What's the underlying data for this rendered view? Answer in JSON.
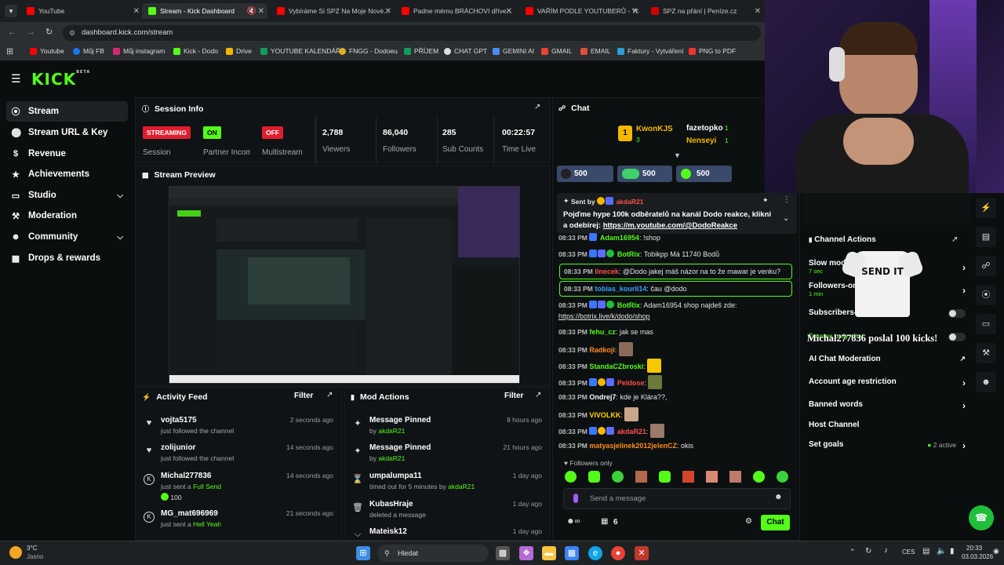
{
  "browser": {
    "tabs": [
      {
        "label": "YouTube",
        "color": "#ff0000"
      },
      {
        "label": "Stream - Kick Dashboard",
        "color": "#53fc18"
      },
      {
        "label": "Vybíráme Si SPZ Na Moje Nové...",
        "color": "#ff0000"
      },
      {
        "label": "Padne mému BRÁCHOVI dříve...",
        "color": "#ff0000"
      },
      {
        "label": "VAŘÍM PODLE YOUTUBERŮ - Yo...",
        "color": "#ff0000"
      },
      {
        "label": "SPZ na přání | Peníze.cz",
        "color": "#d40000"
      }
    ],
    "url": "dashboard.kick.com/stream",
    "bookmarks": [
      "Youtube",
      "Můj FB",
      "Můj instagram",
      "Kick - Dodo",
      "Drive",
      "YOUTUBE KALENDÁŘ",
      "FNGG - Dodoeu",
      "PŘÍJEM",
      "CHAT GPT",
      "GEMINI AI",
      "GMAIL",
      "EMAIL",
      "Faktury - Vytváření",
      "PNG to PDF"
    ]
  },
  "app": {
    "logo": "KICK",
    "logo_sup": "BETA"
  },
  "sidebar": {
    "items": [
      {
        "label": "Stream",
        "icon": "broadcast-icon"
      },
      {
        "label": "Stream URL & Key",
        "icon": "key-icon"
      },
      {
        "label": "Revenue",
        "icon": "dollar-icon"
      },
      {
        "label": "Achievements",
        "icon": "trophy-icon"
      },
      {
        "label": "Studio",
        "icon": "monitor-icon"
      },
      {
        "label": "Moderation",
        "icon": "wrench-icon"
      },
      {
        "label": "Community",
        "icon": "people-icon"
      },
      {
        "label": "Drops & rewards",
        "icon": "gift-icon"
      }
    ]
  },
  "session": {
    "title": "Session Info",
    "streaming": "STREAMING",
    "session_label": "Session",
    "on": "ON",
    "partner_label": "Partner Income",
    "off": "OFF",
    "multistream_label": "Multistream",
    "viewers": "2,788",
    "viewers_label": "Viewers",
    "followers": "86,040",
    "followers_label": "Followers",
    "subs": "285",
    "subs_label": "Sub Counts",
    "time": "00:22:57",
    "time_label": "Time Live"
  },
  "preview": {
    "title": "Stream Preview"
  },
  "activity": {
    "title": "Activity Feed",
    "filter": "Filter",
    "items": [
      {
        "name": "vojta5175",
        "text": "just followed the channel",
        "time": "2 seconds ago",
        "icon": "heart-icon"
      },
      {
        "name": "zolijunior",
        "text": "just followed the channel",
        "time": "14 seconds ago",
        "icon": "heart-icon"
      },
      {
        "name": "Michal277836",
        "text": "just sent a ",
        "gift": "Full Send",
        "amount": "100",
        "time": "14 seconds ago",
        "icon": "kick-icon"
      },
      {
        "name": "MG_mat696969",
        "text": "just sent a ",
        "gift": "Hell Yeah",
        "time": "21 seconds ago",
        "icon": "kick-icon"
      }
    ]
  },
  "mod": {
    "title": "Mod Actions",
    "filter": "Filter",
    "items": [
      {
        "name": "Message Pinned",
        "pre": "by ",
        "by": "akdaR21",
        "time": "8 hours ago",
        "icon": "pin-icon"
      },
      {
        "name": "Message Pinned",
        "pre": "by ",
        "by": "akdaR21",
        "time": "21 hours ago",
        "icon": "pin-icon"
      },
      {
        "name": "umpalumpa11",
        "pre": "timed out for 5 minutes by ",
        "by": "akdaR21",
        "time": "1 day ago",
        "icon": "hourglass-icon"
      },
      {
        "name": "KubasHraje",
        "pre": "deleted a message",
        "by": "",
        "time": "1 day ago",
        "icon": "trash-icon"
      },
      {
        "name": "Mateisk12",
        "pre": "",
        "by": "",
        "time": "1 day ago",
        "icon": "chevron-down-icon"
      }
    ]
  },
  "chat": {
    "title": "Chat",
    "leader1": {
      "name": "KwonKJS",
      "num": "3"
    },
    "leader2": {
      "name": "fazetopko",
      "num": "1"
    },
    "leader3": {
      "name": "Nenseyi",
      "num": "1"
    },
    "pills": [
      "500",
      "500",
      "500"
    ],
    "pinned": {
      "sent_by": "Sent by",
      "user": "akdaR21",
      "text": "Pojďme hype 100k odběratelů na kanál Dodo reakce, klikni a odebírej: ",
      "link": "https://m.youtube.com/@DodoReakce"
    },
    "messages": [
      {
        "time": "08:33 PM",
        "user": "Adam16954",
        "color": "#53fc18",
        "text": "!shop"
      },
      {
        "time": "08:33 PM",
        "user": "BotRix",
        "color": "#53fc18",
        "text": "Tobikpp Má 11740 Bodů"
      },
      {
        "time": "08:33 PM",
        "user": "linecek",
        "color": "#ff4d4d",
        "text": "@Dodo jakej máš názor na to že mawar je venku?"
      },
      {
        "time": "08:33 PM",
        "user": "tobias_kouril14",
        "color": "#3aa0ff",
        "text": "čau @dodo"
      },
      {
        "time": "08:33 PM",
        "user": "BotRix",
        "color": "#53fc18",
        "text": "Adam16954 shop najdeš zde:"
      },
      {
        "time": "",
        "user": "",
        "color": "",
        "text": "https://botrix.live/k/dodo/shop"
      },
      {
        "time": "08:33 PM",
        "user": "fehu_cz",
        "color": "#53fc18",
        "text": "jak se mas"
      },
      {
        "time": "08:33 PM",
        "user": "Radkoji",
        "color": "#ff8c1a",
        "text": ""
      },
      {
        "time": "08:33 PM",
        "user": "StandaCZbroski",
        "color": "#53fc18",
        "text": ""
      },
      {
        "time": "08:33 PM",
        "user": "Peldose",
        "color": "#ff4d4d",
        "text": ""
      },
      {
        "time": "08:33 PM",
        "user": "Ondrej7",
        "color": "#ffffff",
        "text": "kde je Klára??,"
      },
      {
        "time": "08:33 PM",
        "user": "VIVOLKK",
        "color": "#ffd400",
        "text": ""
      },
      {
        "time": "08:33 PM",
        "user": "akdaR21",
        "color": "#ff4d4d",
        "text": ""
      },
      {
        "time": "08:33 PM",
        "user": "matyasjelinek2012jelenCZ",
        "color": "#ff8c1a",
        "text": "okis"
      }
    ],
    "followers_only": "Followers only",
    "input_placeholder": "Send a message",
    "count": "6",
    "send": "Chat"
  },
  "channel_actions": {
    "title": "Channel Actions",
    "items": [
      {
        "label": "Slow mode",
        "sub": "7 sec"
      },
      {
        "label": "Followers-only",
        "sub": "1 min"
      },
      {
        "label": "Subscribers-only",
        "sub": ""
      },
      {
        "label": "Emotes only chat",
        "sub": ""
      },
      {
        "label": "AI Chat Moderation",
        "sub": ""
      },
      {
        "label": "Account age restriction",
        "sub": ""
      },
      {
        "label": "Banned words",
        "sub": ""
      },
      {
        "label": "Host Channel",
        "sub": ""
      },
      {
        "label": "Set goals",
        "sub": ""
      }
    ],
    "goals_active": "2 active",
    "alert_text": "Michal277836 poslal 100 kicks!",
    "alert_shirt": "SEND IT"
  },
  "taskbar": {
    "weather_temp": "3°C",
    "weather_desc": "Jasno",
    "search": "Hledat",
    "lang": "CES",
    "time": "20:33",
    "date": "03.03.2026"
  },
  "colors": {
    "accent": "#53fc18",
    "bg": "#0b0e0f",
    "panel": "#101315",
    "streaming_red": "#e11d2e"
  }
}
